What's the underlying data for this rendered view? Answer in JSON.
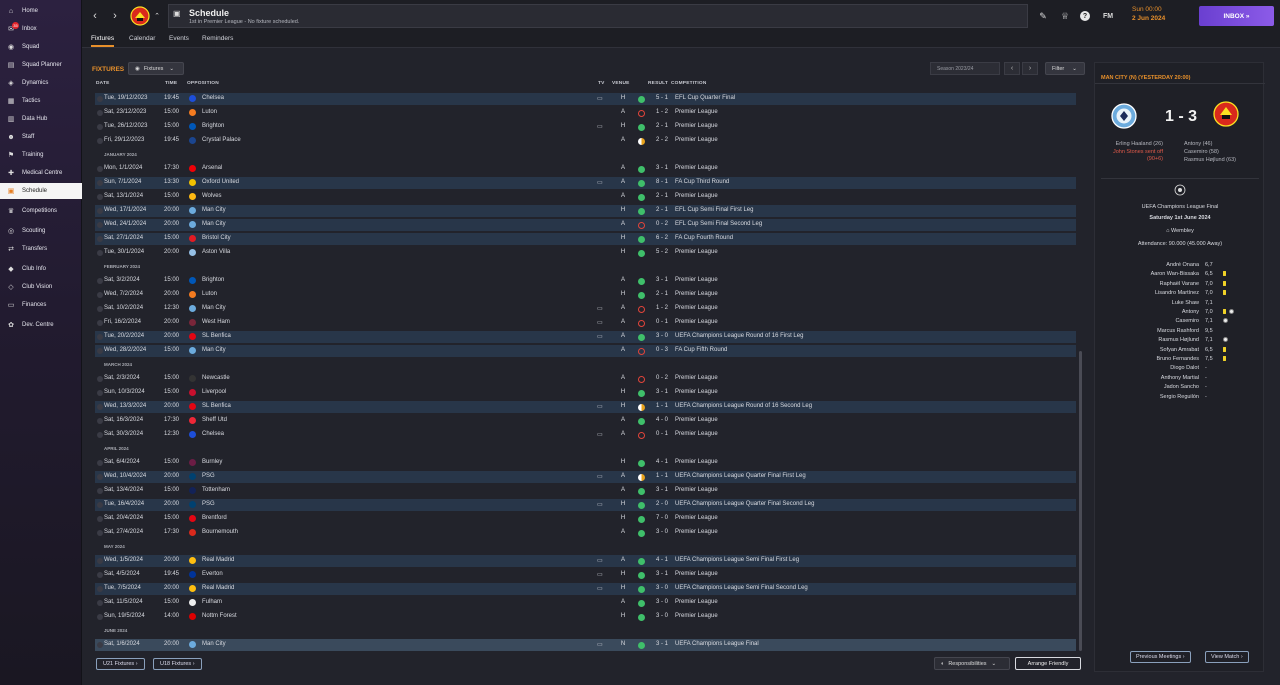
{
  "sidebar": {
    "items": [
      {
        "label": "Home",
        "icon": "home-icon",
        "glyph": "⌂"
      },
      {
        "label": "Inbox",
        "icon": "inbox-icon",
        "glyph": "✉",
        "badge": "35"
      },
      {
        "label": "Squad",
        "icon": "squad-icon",
        "glyph": "◉"
      },
      {
        "label": "Squad Planner",
        "icon": "squad-planner-icon",
        "glyph": "▤"
      },
      {
        "label": "Dynamics",
        "icon": "dynamics-icon",
        "glyph": "◈"
      },
      {
        "label": "Tactics",
        "icon": "tactics-icon",
        "glyph": "▦"
      },
      {
        "label": "Data Hub",
        "icon": "data-hub-icon",
        "glyph": "▥"
      },
      {
        "label": "Staff",
        "icon": "staff-icon",
        "glyph": "☻"
      },
      {
        "label": "Training",
        "icon": "training-icon",
        "glyph": "⚑"
      },
      {
        "label": "Medical Centre",
        "icon": "medical-icon",
        "glyph": "✚"
      },
      {
        "label": "Schedule",
        "icon": "calendar-icon",
        "glyph": "▣",
        "active": true
      },
      {
        "label": "Competitions",
        "icon": "trophy-icon",
        "glyph": "♛"
      },
      {
        "label": "Scouting",
        "icon": "scouting-icon",
        "glyph": "◎"
      },
      {
        "label": "Transfers",
        "icon": "transfers-icon",
        "glyph": "⇄"
      },
      {
        "label": "Club Info",
        "icon": "club-info-icon",
        "glyph": "◆"
      },
      {
        "label": "Club Vision",
        "icon": "club-vision-icon",
        "glyph": "◇"
      },
      {
        "label": "Finances",
        "icon": "finances-icon",
        "glyph": "▭"
      },
      {
        "label": "Dev. Centre",
        "icon": "dev-centre-icon",
        "glyph": "✿"
      }
    ]
  },
  "topbar": {
    "title": "Schedule",
    "subtitle": "1st in Premier League - No fixture scheduled.",
    "fm_label": "FM",
    "date_line1": "Sun 00:00",
    "date_line2": "2 Jun 2024",
    "inbox_label": "INBOX  »"
  },
  "tabs": [
    "Fixtures",
    "Calendar",
    "Events",
    "Reminders"
  ],
  "fixtures": {
    "title": "FIXTURES",
    "dropdown_label": "Fixtures",
    "season": "Season 2023/24",
    "filter_label": "Filter",
    "headers": {
      "date": "DATE",
      "time": "TIME",
      "opposition": "OPPOSITION",
      "tv": "TV",
      "venue": "VENUE",
      "result": "RESULT",
      "competition": "COMPETITION"
    },
    "rows": [
      {
        "type": "m",
        "date": "Tue, 19/12/2023",
        "time": "19:45",
        "opp": "Chelsea",
        "crest": "#1d4ed8",
        "tv": true,
        "venue": "H",
        "res": "W",
        "score": "5 - 1",
        "comp": "EFL Cup Quarter Final",
        "hl": true
      },
      {
        "type": "m",
        "date": "Sat, 23/12/2023",
        "time": "15:00",
        "opp": "Luton",
        "crest": "#f47b20",
        "tv": false,
        "venue": "A",
        "res": "L",
        "score": "1 - 2",
        "comp": "Premier League"
      },
      {
        "type": "m",
        "date": "Tue, 26/12/2023",
        "time": "15:00",
        "opp": "Brighton",
        "crest": "#0057b8",
        "tv": true,
        "venue": "H",
        "res": "W",
        "score": "2 - 1",
        "comp": "Premier League"
      },
      {
        "type": "m",
        "date": "Fri, 29/12/2023",
        "time": "19:45",
        "opp": "Crystal Palace",
        "crest": "#1b458f",
        "tv": false,
        "venue": "A",
        "res": "D",
        "score": "2 - 2",
        "comp": "Premier League"
      },
      {
        "type": "h",
        "label": "JANUARY 2024"
      },
      {
        "type": "m",
        "date": "Mon, 1/1/2024",
        "time": "17:30",
        "opp": "Arsenal",
        "crest": "#ef0107",
        "tv": false,
        "venue": "A",
        "res": "W",
        "score": "3 - 1",
        "comp": "Premier League"
      },
      {
        "type": "m",
        "date": "Sun, 7/1/2024",
        "time": "13:30",
        "opp": "Oxford United",
        "crest": "#f2c200",
        "tv": true,
        "venue": "A",
        "res": "W",
        "score": "8 - 1",
        "comp": "FA Cup Third Round",
        "hl": true
      },
      {
        "type": "m",
        "date": "Sat, 13/1/2024",
        "time": "15:00",
        "opp": "Wolves",
        "crest": "#fdb913",
        "tv": false,
        "venue": "A",
        "res": "W",
        "score": "2 - 1",
        "comp": "Premier League"
      },
      {
        "type": "m",
        "date": "Wed, 17/1/2024",
        "time": "20:00",
        "opp": "Man City",
        "crest": "#6cabdd",
        "tv": false,
        "venue": "H",
        "res": "W",
        "score": "2 - 1",
        "comp": "EFL Cup Semi Final First Leg",
        "hl": true
      },
      {
        "type": "m",
        "date": "Wed, 24/1/2024",
        "time": "20:00",
        "opp": "Man City",
        "crest": "#6cabdd",
        "tv": false,
        "venue": "A",
        "res": "L",
        "score": "0 - 2",
        "comp": "EFL Cup Semi Final Second Leg",
        "hl": true
      },
      {
        "type": "m",
        "date": "Sat, 27/1/2024",
        "time": "15:00",
        "opp": "Bristol City",
        "crest": "#e21b23",
        "tv": false,
        "venue": "H",
        "res": "W",
        "score": "6 - 2",
        "comp": "FA Cup Fourth Round",
        "hl": true
      },
      {
        "type": "m",
        "date": "Tue, 30/1/2024",
        "time": "20:00",
        "opp": "Aston Villa",
        "crest": "#95bfe5",
        "tv": false,
        "venue": "H",
        "res": "W",
        "score": "5 - 2",
        "comp": "Premier League"
      },
      {
        "type": "h",
        "label": "FEBRUARY 2024"
      },
      {
        "type": "m",
        "date": "Sat, 3/2/2024",
        "time": "15:00",
        "opp": "Brighton",
        "crest": "#0057b8",
        "tv": false,
        "venue": "A",
        "res": "W",
        "score": "3 - 1",
        "comp": "Premier League"
      },
      {
        "type": "m",
        "date": "Wed, 7/2/2024",
        "time": "20:00",
        "opp": "Luton",
        "crest": "#f47b20",
        "tv": false,
        "venue": "H",
        "res": "W",
        "score": "2 - 1",
        "comp": "Premier League"
      },
      {
        "type": "m",
        "date": "Sat, 10/2/2024",
        "time": "12:30",
        "opp": "Man City",
        "crest": "#6cabdd",
        "tv": true,
        "venue": "A",
        "res": "L",
        "score": "1 - 2",
        "comp": "Premier League"
      },
      {
        "type": "m",
        "date": "Fri, 16/2/2024",
        "time": "20:00",
        "opp": "West Ham",
        "crest": "#7a263a",
        "tv": true,
        "venue": "A",
        "res": "L",
        "score": "0 - 1",
        "comp": "Premier League"
      },
      {
        "type": "m",
        "date": "Tue, 20/2/2024",
        "time": "20:00",
        "opp": "SL Benfica",
        "crest": "#e30613",
        "tv": true,
        "venue": "A",
        "res": "W",
        "score": "3 - 0",
        "comp": "UEFA Champions League Round of 16 First Leg",
        "hl": true
      },
      {
        "type": "m",
        "date": "Wed, 28/2/2024",
        "time": "15:00",
        "opp": "Man City",
        "crest": "#6cabdd",
        "tv": false,
        "venue": "A",
        "res": "L",
        "score": "0 - 3",
        "comp": "FA Cup Fifth Round",
        "hl": true
      },
      {
        "type": "h",
        "label": "MARCH 2024"
      },
      {
        "type": "m",
        "date": "Sat, 2/3/2024",
        "time": "15:00",
        "opp": "Newcastle",
        "crest": "#333333",
        "tv": false,
        "venue": "A",
        "res": "L",
        "score": "0 - 2",
        "comp": "Premier League"
      },
      {
        "type": "m",
        "date": "Sun, 10/3/2024",
        "time": "15:00",
        "opp": "Liverpool",
        "crest": "#c8102e",
        "tv": false,
        "venue": "H",
        "res": "W",
        "score": "3 - 1",
        "comp": "Premier League"
      },
      {
        "type": "m",
        "date": "Wed, 13/3/2024",
        "time": "20:00",
        "opp": "SL Benfica",
        "crest": "#e30613",
        "tv": true,
        "venue": "H",
        "res": "D",
        "score": "1 - 1",
        "comp": "UEFA Champions League Round of 16 Second Leg",
        "hl": true
      },
      {
        "type": "m",
        "date": "Sat, 16/3/2024",
        "time": "17:30",
        "opp": "Sheff Utd",
        "crest": "#ee2737",
        "tv": false,
        "venue": "A",
        "res": "W",
        "score": "4 - 0",
        "comp": "Premier League"
      },
      {
        "type": "m",
        "date": "Sat, 30/3/2024",
        "time": "12:30",
        "opp": "Chelsea",
        "crest": "#1d4ed8",
        "tv": true,
        "venue": "A",
        "res": "L",
        "score": "0 - 1",
        "comp": "Premier League"
      },
      {
        "type": "h",
        "label": "APRIL 2024"
      },
      {
        "type": "m",
        "date": "Sat, 6/4/2024",
        "time": "15:00",
        "opp": "Burnley",
        "crest": "#6c1d45",
        "tv": false,
        "venue": "H",
        "res": "W",
        "score": "4 - 1",
        "comp": "Premier League"
      },
      {
        "type": "m",
        "date": "Wed, 10/4/2024",
        "time": "20:00",
        "opp": "PSG",
        "crest": "#004170",
        "tv": true,
        "venue": "A",
        "res": "D",
        "score": "1 - 1",
        "comp": "UEFA Champions League Quarter Final First Leg",
        "hl": true
      },
      {
        "type": "m",
        "date": "Sat, 13/4/2024",
        "time": "15:00",
        "opp": "Tottenham",
        "crest": "#132257",
        "tv": false,
        "venue": "A",
        "res": "W",
        "score": "3 - 1",
        "comp": "Premier League"
      },
      {
        "type": "m",
        "date": "Tue, 16/4/2024",
        "time": "20:00",
        "opp": "PSG",
        "crest": "#004170",
        "tv": true,
        "venue": "H",
        "res": "W",
        "score": "2 - 0",
        "comp": "UEFA Champions League Quarter Final Second Leg",
        "hl": true
      },
      {
        "type": "m",
        "date": "Sat, 20/4/2024",
        "time": "15:00",
        "opp": "Brentford",
        "crest": "#e30613",
        "tv": false,
        "venue": "H",
        "res": "W",
        "score": "7 - 0",
        "comp": "Premier League"
      },
      {
        "type": "m",
        "date": "Sat, 27/4/2024",
        "time": "17:30",
        "opp": "Bournemouth",
        "crest": "#da291c",
        "tv": false,
        "venue": "A",
        "res": "W",
        "score": "3 - 0",
        "comp": "Premier League"
      },
      {
        "type": "h",
        "label": "MAY 2024"
      },
      {
        "type": "m",
        "date": "Wed, 1/5/2024",
        "time": "20:00",
        "opp": "Real Madrid",
        "crest": "#febe10",
        "tv": true,
        "venue": "A",
        "res": "W",
        "score": "4 - 1",
        "comp": "UEFA Champions League Semi Final First Leg",
        "hl": true
      },
      {
        "type": "m",
        "date": "Sat, 4/5/2024",
        "time": "19:45",
        "opp": "Everton",
        "crest": "#003399",
        "tv": true,
        "venue": "H",
        "res": "W",
        "score": "3 - 1",
        "comp": "Premier League"
      },
      {
        "type": "m",
        "date": "Tue, 7/5/2024",
        "time": "20:00",
        "opp": "Real Madrid",
        "crest": "#febe10",
        "tv": true,
        "venue": "H",
        "res": "W",
        "score": "3 - 0",
        "comp": "UEFA Champions League Semi Final Second Leg",
        "hl": true
      },
      {
        "type": "m",
        "date": "Sat, 11/5/2024",
        "time": "15:00",
        "opp": "Fulham",
        "crest": "#eeeeee",
        "tv": false,
        "venue": "A",
        "res": "W",
        "score": "3 - 0",
        "comp": "Premier League"
      },
      {
        "type": "m",
        "date": "Sun, 19/5/2024",
        "time": "14:00",
        "opp": "Nottm Forest",
        "crest": "#dd0000",
        "tv": false,
        "venue": "H",
        "res": "W",
        "score": "3 - 0",
        "comp": "Premier League"
      },
      {
        "type": "h",
        "label": "JUNE 2024"
      },
      {
        "type": "m",
        "date": "Sat, 1/6/2024",
        "time": "20:00",
        "opp": "Man City",
        "crest": "#6cabdd",
        "tv": true,
        "venue": "N",
        "res": "W",
        "score": "3 - 1",
        "comp": "UEFA Champions League Final",
        "sel": true
      }
    ],
    "u21_label": "U21 Fixtures  ›",
    "u18_label": "U18 Fixtures  ›",
    "responsibilities_label": "Responsibilities",
    "friendly_label": "Arrange Friendly"
  },
  "match": {
    "header": "MAN CITY (N) (YESTERDAY 20:00)",
    "score": "1 - 3",
    "home_scorers": [
      {
        "text": "Erling Haaland (26)",
        "red": false
      },
      {
        "text": "John Stones sent off",
        "red": true
      },
      {
        "text": "(90+6)",
        "red": true
      }
    ],
    "away_scorers": [
      "Antony (46)",
      "Casemiro (58)",
      "Rasmus Højlund (63)"
    ],
    "competition": "UEFA Champions League Final",
    "date": "Saturday 1st June 2024",
    "venue": "Wembley",
    "attendance": "Attendance: 90.000 (45.000 Away)",
    "lineup": [
      {
        "name": "André Onana",
        "rating": "6,7",
        "ev": []
      },
      {
        "name": "Aaron Wan-Bissaka",
        "rating": "6,5",
        "ev": [
          "yc"
        ]
      },
      {
        "name": "Raphaël Varane",
        "rating": "7,0",
        "ev": [
          "yc"
        ]
      },
      {
        "name": "Lisandro Martínez",
        "rating": "7,0",
        "ev": [
          "yc"
        ]
      },
      {
        "name": "Luke Shaw",
        "rating": "7,1",
        "ev": []
      },
      {
        "name": "Antony",
        "rating": "7,0",
        "ev": [
          "yc",
          "ball"
        ]
      },
      {
        "name": "Casemiro",
        "rating": "7,1",
        "ev": [
          "ball"
        ]
      },
      {
        "name": "Marcus Rashford",
        "rating": "9,5",
        "ev": []
      },
      {
        "name": "Rasmus Højlund",
        "rating": "7,1",
        "ev": [
          "ball"
        ]
      },
      {
        "name": "Sofyan Amrabat",
        "rating": "6,5",
        "ev": [
          "yc"
        ]
      },
      {
        "name": "Bruno Fernandes",
        "rating": "7,5",
        "ev": [
          "yc"
        ]
      },
      {
        "name": "Diogo Dalot",
        "rating": "-",
        "ev": []
      },
      {
        "name": "Anthony Martial",
        "rating": "-",
        "ev": []
      },
      {
        "name": "Jadon Sancho",
        "rating": "-",
        "ev": []
      },
      {
        "name": "Sergio Reguilón",
        "rating": "-",
        "ev": []
      }
    ],
    "prev_meetings_label": "Previous Meetings  ›",
    "view_match_label": "View Match  ›"
  }
}
